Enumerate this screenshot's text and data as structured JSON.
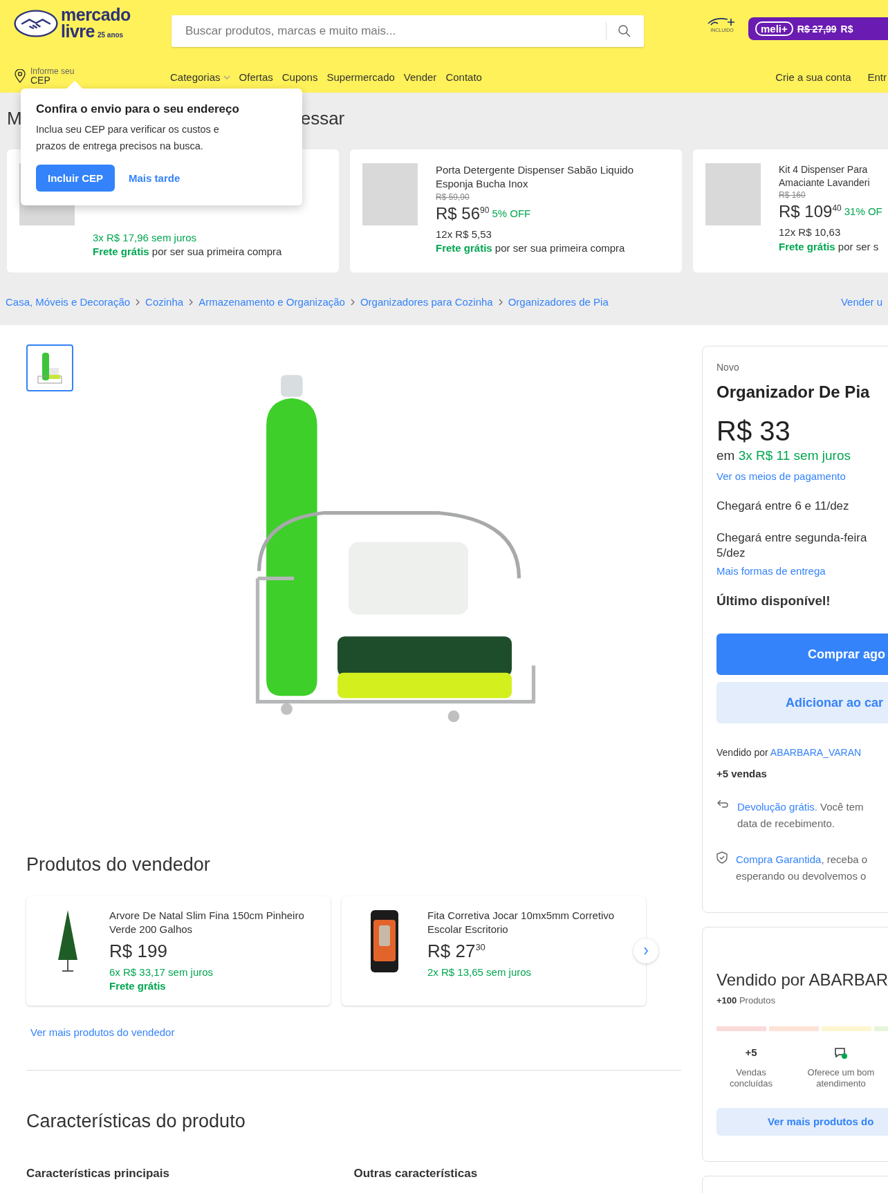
{
  "header": {
    "logo": {
      "line1": "mercado",
      "line2": "livre",
      "tag": "25 anos"
    },
    "search": {
      "placeholder": "Buscar produtos, marcas e muito mais..."
    },
    "promo": {
      "disney_note": "INCLUIDO",
      "badge": "meli+",
      "old_price": "R$ 27,99",
      "new_price": "R$"
    },
    "location": {
      "line1": "Informe seu",
      "line2": "CEP"
    },
    "nav": [
      {
        "label": "Categorias",
        "kind": "dropdown"
      },
      {
        "label": "Ofertas",
        "kind": "link"
      },
      {
        "label": "Cupons",
        "kind": "link"
      },
      {
        "label": "Supermercado",
        "kind": "link"
      },
      {
        "label": "Vender",
        "kind": "link"
      },
      {
        "label": "Contato",
        "kind": "link"
      }
    ],
    "account_links": [
      "Crie a sua conta",
      "Entr"
    ]
  },
  "popup": {
    "title": "Confira o envio para o seu endereço",
    "text": "Inclua seu CEP para verificar os custos e prazos de entrega precisos na busca.",
    "primary_button": "Incluir CEP",
    "secondary_button": "Mais tarde"
  },
  "recommendations": {
    "heading_parts": [
      "M",
      "essar"
    ],
    "cards": [
      {
        "installments": "3x R$ 17,96 sem juros",
        "interest_free": true,
        "shipping_bold": "Frete grátis",
        "shipping_rest": "por ser sua primeira compra"
      },
      {
        "title": "Porta Detergente Dispenser Sabão Liquido Esponja Bucha Inox",
        "old_price": "R$ 59,90",
        "price": "R$ 56",
        "cents": "90",
        "discount": "5% OFF",
        "installments": "12x R$ 5,53",
        "interest_free": false,
        "shipping_bold": "Frete grátis",
        "shipping_rest": "por ser sua primeira compra"
      },
      {
        "title": "Kit 4 Dispenser Para Amaciante Lavanderi",
        "old_price": "R$ 160",
        "price": "R$ 109",
        "cents": "40",
        "discount": "31% OF",
        "installments": "12x R$ 10,63",
        "interest_free": false,
        "shipping_bold": "Frete grátis",
        "shipping_rest": "por ser s"
      }
    ]
  },
  "breadcrumb": [
    "Casa, Móveis e Decoração",
    "Cozinha",
    "Armazenamento e Organização",
    "Organizadores para Cozinha",
    "Organizadores de Pia"
  ],
  "sell_link": "Vender u",
  "product": {
    "condition": "Novo",
    "title": "Organizador De Pia",
    "price": "R$ 33",
    "installments_prefix": "em",
    "installments": "3x R$ 11 sem juros",
    "payment_link": "Ver os meios de pagamento",
    "delivery": [
      "Chegará entre 6 e 11/dez",
      "Chegará entre segunda-feira 5/dez"
    ],
    "more_delivery": "Mais formas de entrega",
    "stock": "Último disponível!",
    "buy_button": "Comprar ago",
    "cart_button": "Adicionar ao car",
    "seller_prefix": "Vendido por",
    "seller_name": "ABARBARA_VARAN",
    "sales": "+5 vendas",
    "guarantees": [
      {
        "kind": "return",
        "link": "Devolução grátis.",
        "text": "Você tem",
        "text2": "data de recebimento."
      },
      {
        "kind": "shield",
        "link": "Compra Garantida",
        "text": ", receba o",
        "text2": "esperando ou devolvemos o"
      }
    ]
  },
  "seller_card": {
    "title": "Vendido por ABARBAR",
    "products_count": "+100",
    "products_label": "Produtos",
    "metrics": [
      {
        "kind": "number",
        "value": "+5",
        "label": "Vendas concluídas"
      },
      {
        "kind": "icon",
        "label": "Oferece um bom atendimento"
      }
    ],
    "button": "Ver mais produtos do"
  },
  "seller_products": {
    "heading": "Produtos do vendedor",
    "items": [
      {
        "title": "Arvore De Natal Slim Fina 150cm Pinheiro Verde 200 Galhos",
        "price": "R$ 199",
        "installments": "6x R$ 33,17 sem juros",
        "shipping": "Frete grátis"
      },
      {
        "title": "Fita Corretiva Jocar 10mx5mm Corretivo Escolar Escritorio",
        "price": "R$ 27",
        "cents": "30",
        "installments": "2x R$ 13,65 sem juros"
      }
    ],
    "link": "Ver mais produtos do vendedor"
  },
  "characteristics": {
    "heading": "Características do produto",
    "subheadings": [
      "Características principais",
      "Outras características"
    ]
  }
}
